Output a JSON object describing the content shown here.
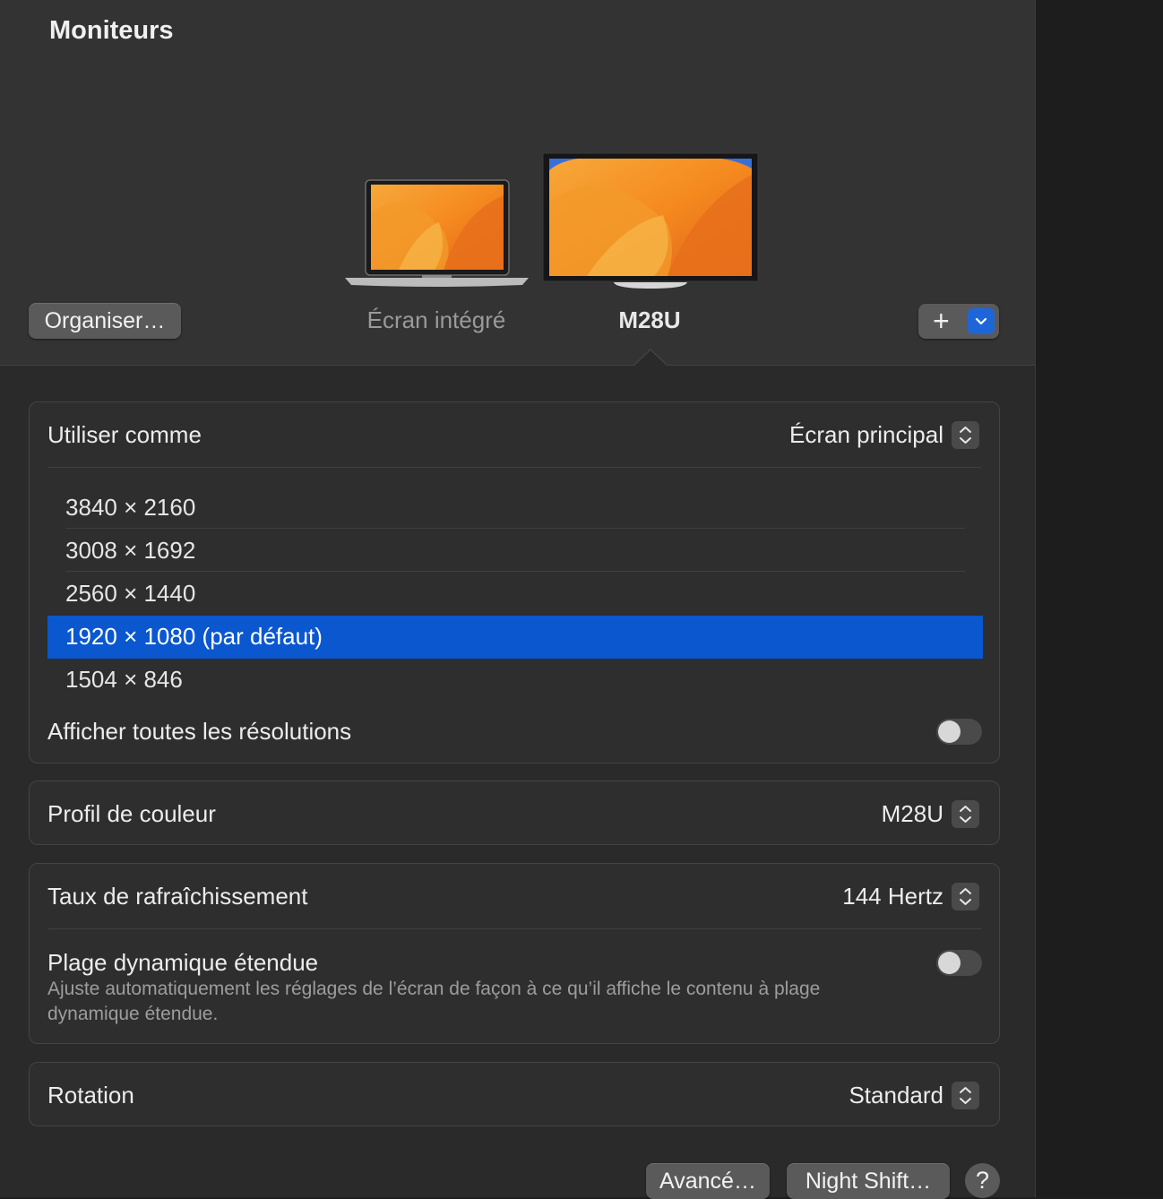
{
  "title": "Moniteurs",
  "header": {
    "arrange_button": "Organiser…",
    "displays": [
      {
        "label": "Écran intégré",
        "selected": false
      },
      {
        "label": "M28U",
        "selected": true
      }
    ],
    "add_button": "+"
  },
  "use_as": {
    "label": "Utiliser comme",
    "value": "Écran principal"
  },
  "resolutions": [
    {
      "label": "3840 × 2160",
      "selected": false
    },
    {
      "label": "3008 × 1692",
      "selected": false
    },
    {
      "label": "2560 × 1440",
      "selected": false
    },
    {
      "label": "1920 × 1080 (par défaut)",
      "selected": true
    },
    {
      "label": "1504 × 846",
      "selected": false
    }
  ],
  "show_all_resolutions": {
    "label": "Afficher toutes les résolutions",
    "on": false
  },
  "color_profile": {
    "label": "Profil de couleur",
    "value": "M28U"
  },
  "refresh_rate": {
    "label": "Taux de rafraîchissement",
    "value": "144 Hertz"
  },
  "hdr": {
    "label": "Plage dynamique étendue",
    "description": "Ajuste automatiquement les réglages de l’écran de façon à ce qu’il affiche le contenu à plage dynamique étendue.",
    "on": false
  },
  "rotation": {
    "label": "Rotation",
    "value": "Standard"
  },
  "footer": {
    "advanced_button": "Avancé…",
    "night_shift_button": "Night Shift…",
    "help_button": "?"
  },
  "colors": {
    "accent": "#0a57cf",
    "window_bg": "#2a2a2a",
    "header_bg": "#333333"
  }
}
